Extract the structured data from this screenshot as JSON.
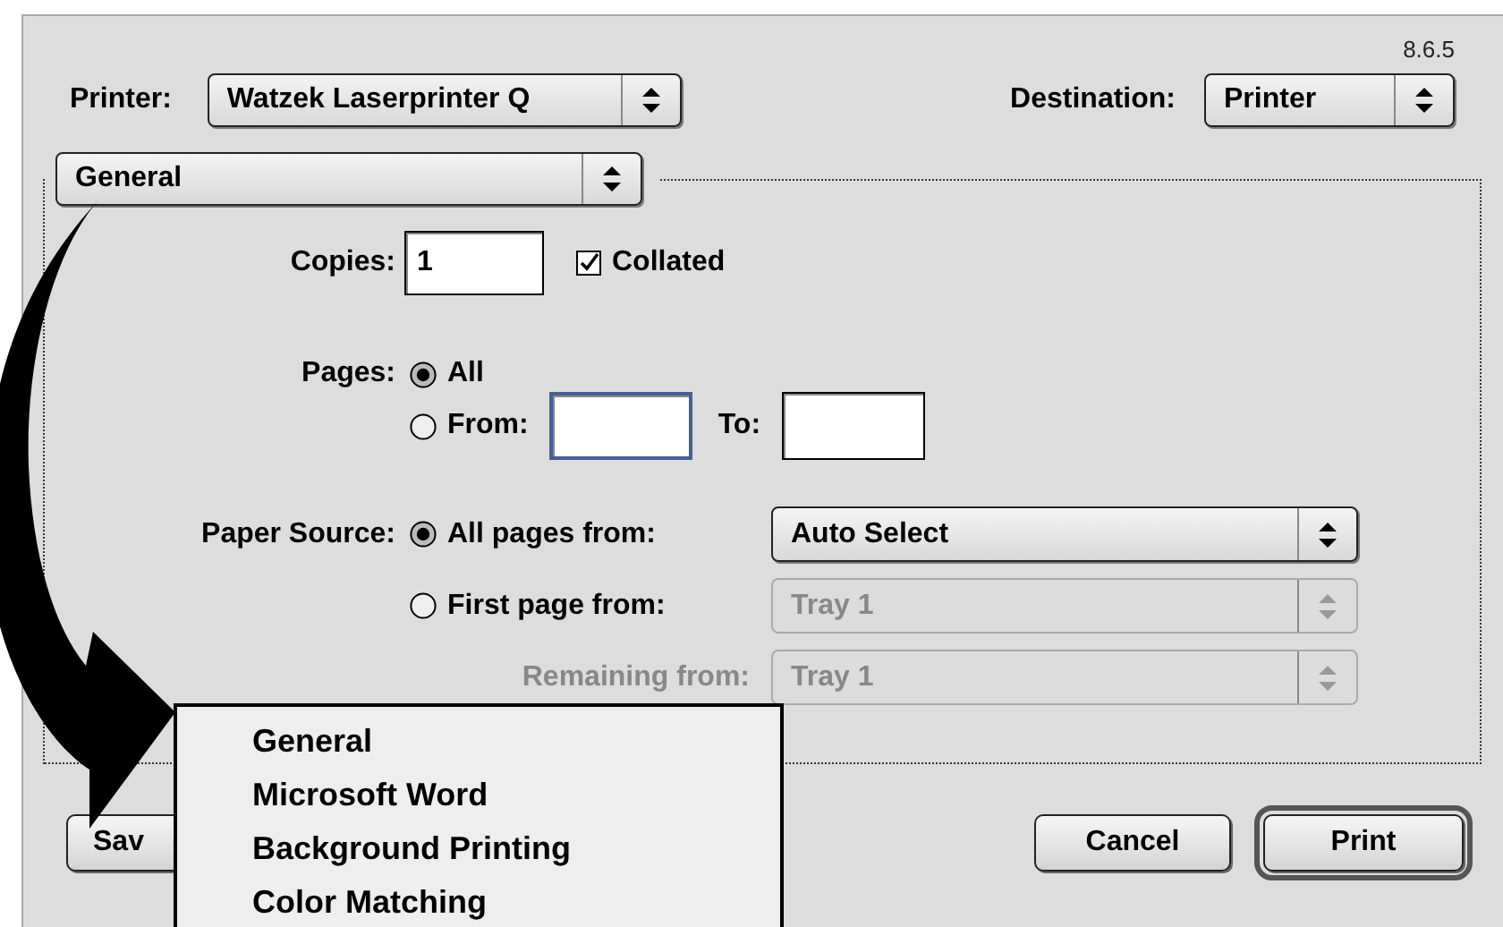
{
  "version": "8.6.5",
  "printer": {
    "label": "Printer:",
    "value": "Watzek Laserprinter Q"
  },
  "destination": {
    "label": "Destination:",
    "value": "Printer"
  },
  "panel_popup": {
    "value": "General"
  },
  "copies": {
    "label": "Copies:",
    "value": "1"
  },
  "collated": {
    "label": "Collated",
    "checked": true
  },
  "pages": {
    "label": "Pages:",
    "options": [
      {
        "label": "All",
        "selected": true
      },
      {
        "label": "From:",
        "selected": false
      }
    ],
    "from_field": {
      "focused": true
    },
    "to_label": "To:",
    "to_field": {
      "focused": false
    }
  },
  "paper_source": {
    "label": "Paper Source:",
    "options": [
      {
        "label": "All pages from:",
        "selected": true,
        "popup": "Auto Select",
        "disabled": false
      },
      {
        "label": "First page from:",
        "selected": false,
        "popup": "Tray 1",
        "disabled": true
      }
    ],
    "remaining": {
      "label": "Remaining from:",
      "popup": "Tray 1",
      "disabled": true
    }
  },
  "buttons": [
    {
      "label": "Sav",
      "kind": "plain"
    },
    {
      "label": "Cancel",
      "kind": "plain"
    },
    {
      "label": "Print",
      "kind": "default"
    }
  ],
  "menu": {
    "items": [
      {
        "label": "General"
      },
      {
        "label": "Microsoft Word"
      },
      {
        "label": "Background Printing"
      },
      {
        "label": "Color Matching"
      }
    ]
  }
}
